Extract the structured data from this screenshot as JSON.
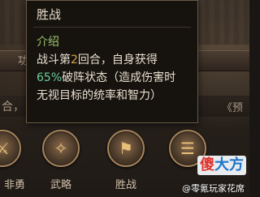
{
  "background": {
    "row1_left": "功",
    "row1_right": "",
    "row2_left": "合，",
    "row2_right": "《预"
  },
  "tooltip": {
    "title": "胜战",
    "section_label": "介绍",
    "line1_pre": "战斗第",
    "line1_round": "2",
    "line1_post": "回合，自身获得",
    "line2_pct": "65%",
    "line2_post": "破阵状态（造成伤害时",
    "line3": "无视目标的统率和智力）"
  },
  "skills": [
    {
      "label": "非勇",
      "icon": "sword-icon"
    },
    {
      "label": "武略",
      "icon": "fan-icon"
    },
    {
      "label": "胜战",
      "icon": "banner-icon"
    },
    {
      "label": "",
      "icon": "scroll-icon"
    }
  ],
  "watermark": {
    "logo_char1": "傻",
    "logo_char2": "大方",
    "caption": "@零氪玩家花席"
  },
  "colors": {
    "highlight_gold": "#d9a24a",
    "highlight_green": "#6fcf9a",
    "section_green": "#9bbf6a"
  }
}
